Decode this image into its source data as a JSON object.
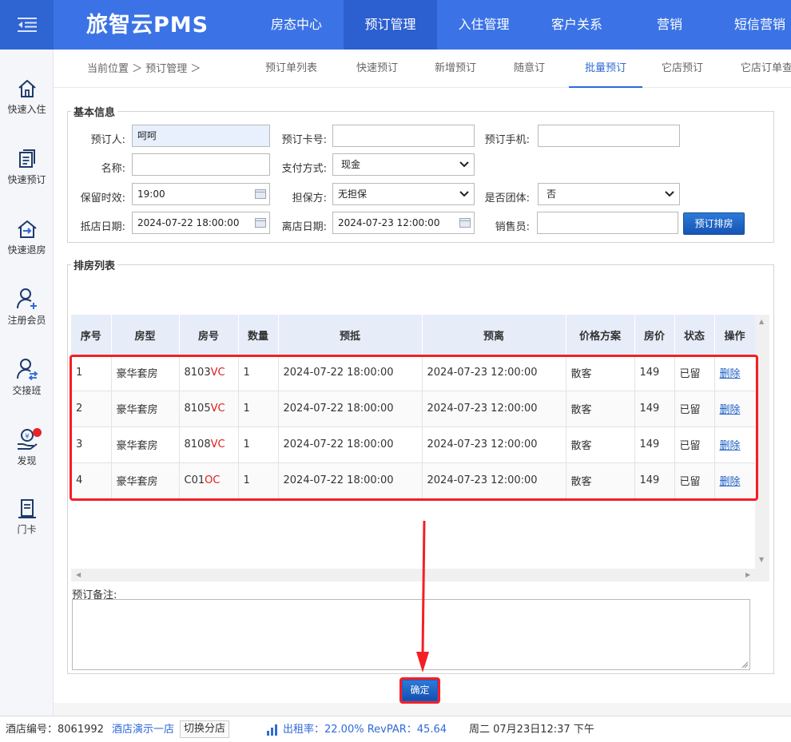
{
  "app": {
    "logo": "旅智云PMS"
  },
  "topnav": [
    "房态中心",
    "预订管理",
    "入住管理",
    "客户关系",
    "营销",
    "短信营销"
  ],
  "sidebar": [
    {
      "label": "快速入住",
      "icon": "home-icon"
    },
    {
      "label": "快速预订",
      "icon": "document-stack-icon"
    },
    {
      "label": "快速退房",
      "icon": "checkout-house-icon"
    },
    {
      "label": "注册会员",
      "icon": "add-user-icon"
    },
    {
      "label": "交接班",
      "icon": "handover-user-icon"
    },
    {
      "label": "发现",
      "icon": "money-hand-icon"
    },
    {
      "label": "门卡",
      "icon": "door-card-icon"
    }
  ],
  "breadcrumb": "当前位置 ＞ 预订管理 ＞",
  "subtabs": [
    "预订单列表",
    "快速预订",
    "新增预订",
    "随意订",
    "批量预订",
    "它店预订",
    "它店订单查"
  ],
  "basic": {
    "legend": "基本信息",
    "booker_label": "预订人:",
    "booker_value": "呵呵",
    "card_label": "预订卡号:",
    "card_value": "",
    "phone_label": "预订手机:",
    "phone_value": "",
    "name_label": "名称:",
    "name_value": "",
    "pay_label": "支付方式:",
    "pay_value": "现金",
    "hold_label": "保留时效:",
    "hold_value": "19:00",
    "guarantee_label": "担保方:",
    "guarantee_value": "无担保",
    "group_label": "是否团体:",
    "group_value": "否",
    "arrive_label": "抵店日期:",
    "arrive_value": "2024-07-22 18:00:00",
    "depart_label": "离店日期:",
    "depart_value": "2024-07-23 12:00:00",
    "sales_label": "销售员:",
    "sales_value": "",
    "assign_button": "预订排房"
  },
  "rooms": {
    "legend": "排房列表",
    "headers": [
      "序号",
      "房型",
      "房号",
      "数量",
      "预抵",
      "预离",
      "价格方案",
      "房价",
      "状态",
      "操作"
    ],
    "rows": [
      {
        "no": "1",
        "type": "豪华套房",
        "room": "8103",
        "suffix": "VC",
        "qty": "1",
        "arrive": "2024-07-22 18:00:00",
        "depart": "2024-07-23 12:00:00",
        "plan": "散客",
        "price": "149",
        "status": "已留",
        "action": "删除"
      },
      {
        "no": "2",
        "type": "豪华套房",
        "room": "8105",
        "suffix": "VC",
        "qty": "1",
        "arrive": "2024-07-22 18:00:00",
        "depart": "2024-07-23 12:00:00",
        "plan": "散客",
        "price": "149",
        "status": "已留",
        "action": "删除"
      },
      {
        "no": "3",
        "type": "豪华套房",
        "room": "8108",
        "suffix": "VC",
        "qty": "1",
        "arrive": "2024-07-22 18:00:00",
        "depart": "2024-07-23 12:00:00",
        "plan": "散客",
        "price": "149",
        "status": "已留",
        "action": "删除"
      },
      {
        "no": "4",
        "type": "豪华套房",
        "room": "C01",
        "suffix": "OC",
        "qty": "1",
        "arrive": "2024-07-22 18:00:00",
        "depart": "2024-07-23 12:00:00",
        "plan": "散客",
        "price": "149",
        "status": "已留",
        "action": "删除"
      }
    ]
  },
  "remark_label": "预订备注:",
  "confirm_button": "确定",
  "status": {
    "hotel_no": "酒店编号：8061992",
    "hotel_name": "酒店演示一店",
    "switch": "切换分店",
    "occupancy": "出租率：22.00% RevPAR：45.64",
    "datetime": "周二 07月23日12:37 下午"
  },
  "colors": {
    "brand": "#3b73e6",
    "highlight": "#f41f26",
    "link": "#1b5fc4"
  }
}
